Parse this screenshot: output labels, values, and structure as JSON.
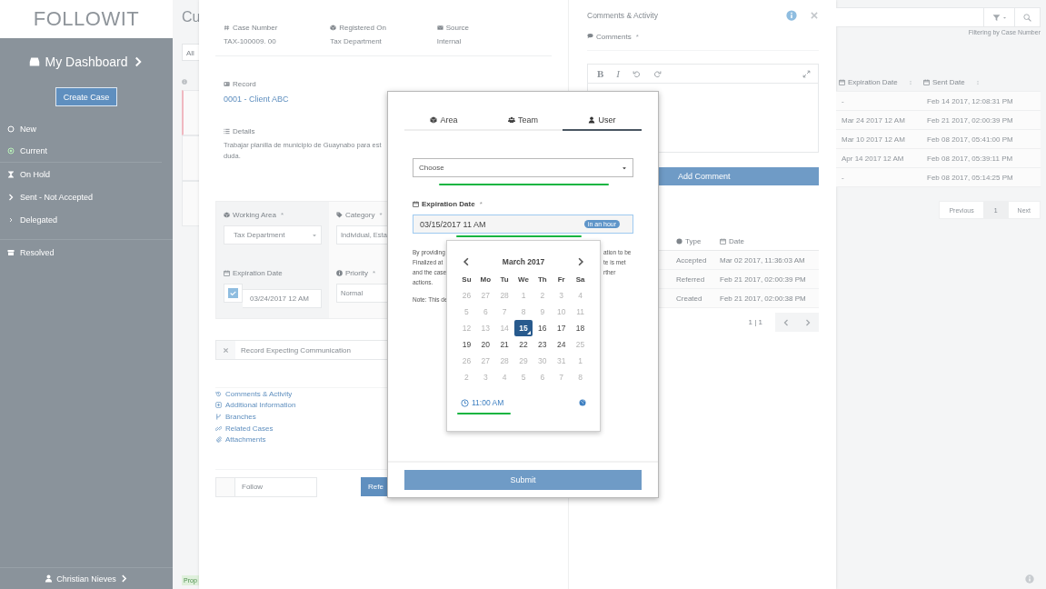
{
  "sidebar": {
    "logo": "FOLLOWIT",
    "dashboard": "My Dashboard",
    "create_button": "Create Case",
    "items": [
      {
        "label": "New",
        "kind": "circle"
      },
      {
        "label": "Current",
        "kind": "target"
      },
      {
        "label": "On Hold",
        "kind": "hourglass"
      },
      {
        "label": "Sent - Not Accepted",
        "kind": "chevron"
      },
      {
        "label": "Delegated",
        "kind": "chevron-small"
      },
      {
        "label": "Resolved",
        "kind": "archive"
      }
    ],
    "user": "Christian Nieves"
  },
  "background": {
    "title": "Cu",
    "filter_tab": "All",
    "status_badge": "Prop",
    "filter_hint": "Filtering by Case Number",
    "table": {
      "columns": [
        "Expiration Date",
        "Sent Date"
      ],
      "rows": [
        [
          "-",
          "Feb 14 2017, 12:08:31 PM"
        ],
        [
          "Mar 24 2017 12 AM",
          "Feb 21 2017, 02:00:39 PM"
        ],
        [
          "Mar 10 2017 12 AM",
          "Feb 08 2017, 05:41:00 PM"
        ],
        [
          "Apr 14 2017 12 AM",
          "Feb 08 2017, 05:39:11 PM"
        ],
        [
          "-",
          "Feb 08 2017, 05:14:25 PM"
        ]
      ]
    },
    "pagination": [
      {
        "label": "Previous",
        "selected": false
      },
      {
        "label": "1",
        "selected": true
      },
      {
        "label": "Next",
        "selected": false
      }
    ]
  },
  "case_panel": {
    "fields": [
      {
        "label": "Case Number",
        "kind": "hash",
        "value": "TAX-100009. 00"
      },
      {
        "label": "Registered On",
        "kind": "cube",
        "value": "Tax Department"
      },
      {
        "label": "Source",
        "kind": "envelope",
        "value": "Internal"
      }
    ],
    "record": {
      "label": "Record",
      "link": "0001 - Client ABC"
    },
    "details": {
      "label": "Details",
      "lines": [
        "Trabajar planilla de municipio de Guaynabo para est",
        "duda."
      ]
    },
    "form": {
      "working_area": {
        "label": "Working Area",
        "req": "*",
        "value": "Tax Department"
      },
      "category": {
        "label": "Category",
        "req": "*",
        "value": "Individual, Esta"
      },
      "expiration": {
        "label": "Expiration Date",
        "checked": true,
        "value": "03/24/2017 12 AM"
      },
      "priority": {
        "label": "Priority",
        "req": "*",
        "value": "Normal"
      }
    },
    "flag": "Record Expecting Communication",
    "links": [
      {
        "label": "Comments & Activity",
        "kind": "history"
      },
      {
        "label": "Additional Information",
        "kind": "plus-square"
      },
      {
        "label": "Branches",
        "kind": "branch"
      },
      {
        "label": "Related Cases",
        "kind": "link"
      },
      {
        "label": "Attachments",
        "kind": "paperclip"
      }
    ],
    "follow": {
      "label": "Follow",
      "checked": false
    },
    "refer_button": "Refe"
  },
  "activity_panel": {
    "title": "Comments & Activity",
    "comments_label": "Comments",
    "req": "*",
    "toolbar": [
      {
        "label": "B",
        "kind": "bold"
      },
      {
        "label": "I",
        "kind": "italic"
      }
    ],
    "add_button": "Add Comment",
    "table": {
      "columns": [
        "Type",
        "Date"
      ],
      "rows": [
        [
          "Accepted",
          "Mar 02 2017, 11:36:03 AM"
        ],
        [
          "Referred",
          "Feb 21 2017, 02:00:39 PM"
        ],
        [
          "Created",
          "Feb 21 2017, 02:00:38 PM"
        ]
      ]
    },
    "page_info": "1 | 1"
  },
  "modal": {
    "tabs": [
      {
        "label": "Area",
        "kind": "cube",
        "selected": false
      },
      {
        "label": "Team",
        "kind": "users",
        "selected": false
      },
      {
        "label": "User",
        "kind": "user",
        "selected": true
      }
    ],
    "select": {
      "placeholder": "Choose",
      "underlined": true
    },
    "expiration": {
      "label": "Expiration Date",
      "req": "*",
      "value": "03/15/2017 11 AM",
      "badge": "in an hour",
      "underlined": true
    },
    "notice_lines": [
      {
        "left": "By providing",
        "right": "ation to be"
      },
      {
        "left": "Finalized at",
        "right": "te is met"
      },
      {
        "left": "and the case",
        "right": "rther"
      },
      {
        "left": "actions."
      }
    ],
    "note": "Note: This de",
    "submit": "Submit",
    "datepicker": {
      "month": "March 2017",
      "weekdays": [
        "Su",
        "Mo",
        "Tu",
        "We",
        "Th",
        "Fr",
        "Sa"
      ],
      "weeks": [
        [
          {
            "day": "26",
            "disabled": true,
            "selected": false
          },
          {
            "day": "27",
            "disabled": true,
            "selected": false
          },
          {
            "day": "28",
            "disabled": true,
            "selected": false
          },
          {
            "day": "1",
            "disabled": true,
            "selected": false
          },
          {
            "day": "2",
            "disabled": true,
            "selected": false
          },
          {
            "day": "3",
            "disabled": true,
            "selected": false
          },
          {
            "day": "4",
            "disabled": true,
            "selected": false
          }
        ],
        [
          {
            "day": "5",
            "disabled": true,
            "selected": false
          },
          {
            "day": "6",
            "disabled": true,
            "selected": false
          },
          {
            "day": "7",
            "disabled": true,
            "selected": false
          },
          {
            "day": "8",
            "disabled": true,
            "selected": false
          },
          {
            "day": "9",
            "disabled": true,
            "selected": false
          },
          {
            "day": "10",
            "disabled": true,
            "selected": false
          },
          {
            "day": "11",
            "disabled": true,
            "selected": false
          }
        ],
        [
          {
            "day": "12",
            "disabled": true,
            "selected": false
          },
          {
            "day": "13",
            "disabled": true,
            "selected": false
          },
          {
            "day": "14",
            "disabled": true,
            "selected": false
          },
          {
            "day": "15",
            "disabled": false,
            "selected": true
          },
          {
            "day": "16",
            "disabled": false,
            "selected": false
          },
          {
            "day": "17",
            "disabled": false,
            "selected": false
          },
          {
            "day": "18",
            "disabled": false,
            "selected": false
          }
        ],
        [
          {
            "day": "19",
            "disabled": false,
            "selected": false
          },
          {
            "day": "20",
            "disabled": false,
            "selected": false
          },
          {
            "day": "21",
            "disabled": false,
            "selected": false
          },
          {
            "day": "22",
            "disabled": false,
            "selected": false
          },
          {
            "day": "23",
            "disabled": false,
            "selected": false
          },
          {
            "day": "24",
            "disabled": false,
            "selected": false
          },
          {
            "day": "25",
            "disabled": true,
            "selected": false
          }
        ],
        [
          {
            "day": "26",
            "disabled": true,
            "selected": false
          },
          {
            "day": "27",
            "disabled": true,
            "selected": false
          },
          {
            "day": "28",
            "disabled": true,
            "selected": false
          },
          {
            "day": "29",
            "disabled": true,
            "selected": false
          },
          {
            "day": "30",
            "disabled": true,
            "selected": false
          },
          {
            "day": "31",
            "disabled": true,
            "selected": false
          },
          {
            "day": "1",
            "disabled": true,
            "selected": false
          }
        ],
        [
          {
            "day": "2",
            "disabled": true,
            "selected": false
          },
          {
            "day": "3",
            "disabled": true,
            "selected": false
          },
          {
            "day": "4",
            "disabled": true,
            "selected": false
          },
          {
            "day": "5",
            "disabled": true,
            "selected": false
          },
          {
            "day": "6",
            "disabled": true,
            "selected": false
          },
          {
            "day": "7",
            "disabled": true,
            "selected": false
          },
          {
            "day": "8",
            "disabled": true,
            "selected": false
          }
        ]
      ],
      "time": "11:00 AM",
      "time_underlined": true
    }
  }
}
